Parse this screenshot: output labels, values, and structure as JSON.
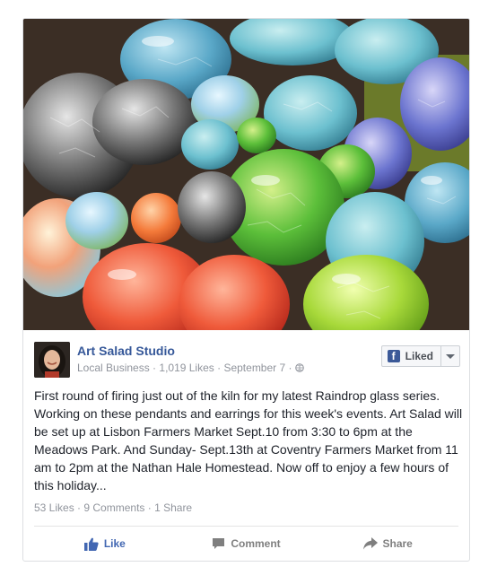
{
  "post": {
    "page_name": "Art Salad Studio",
    "category": "Local Business",
    "likes_count": "1,019 Likes",
    "date": "September 7",
    "liked_button_label": "Liked",
    "text": "First round of firing just out of the kiln for my latest Raindrop glass series. Working on these pendants and earrings for this week's events. Art Salad will be set up at Lisbon Farmers Market Sept.10 from 3:30 to 6pm at the Meadows Park. And Sunday- Sept.13th at Coventry Farmers Market from 11 am to 2pm at the Nathan Hale Homestead. Now off to enjoy a few hours of this holiday...",
    "stats": {
      "likes": "53 Likes",
      "comments": "9 Comments",
      "shares": "1 Share"
    },
    "actions": {
      "like": "Like",
      "comment": "Comment",
      "share": "Share"
    },
    "icons": {
      "globe": "globe-icon",
      "facebook": "facebook-icon",
      "like": "thumbs-up-icon",
      "comment": "comment-icon",
      "share": "share-arrow-icon"
    },
    "colors": {
      "link_blue": "#365899",
      "like_blue": "#4267b2",
      "meta_gray": "#90949c"
    }
  }
}
